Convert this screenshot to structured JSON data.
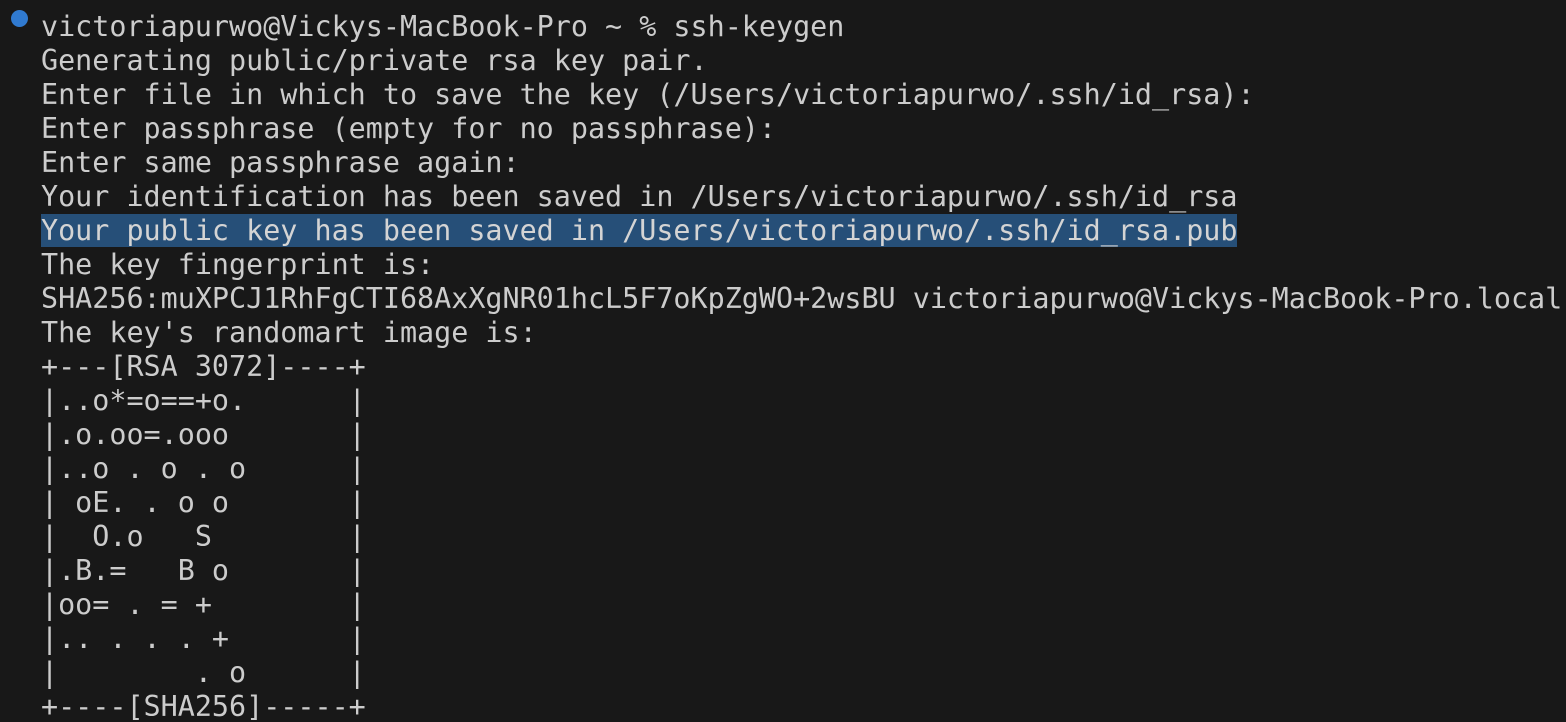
{
  "terminal": {
    "status_dot_color": "#3794ff",
    "highlight_color": "#264f78",
    "lines": [
      "victoriapurwo@Vickys-MacBook-Pro ~ % ssh-keygen",
      "Generating public/private rsa key pair.",
      "Enter file in which to save the key (/Users/victoriapurwo/.ssh/id_rsa):",
      "Enter passphrase (empty for no passphrase):",
      "Enter same passphrase again:",
      "Your identification has been saved in /Users/victoriapurwo/.ssh/id_rsa",
      "Your public key has been saved in /Users/victoriapurwo/.ssh/id_rsa.pub",
      "The key fingerprint is:",
      "SHA256:muXPCJ1RhFgCTI68AxXgNR01hcL5F7oKpZgWO+2wsBU victoriapurwo@Vickys-MacBook-Pro.local",
      "The key's randomart image is:",
      "+---[RSA 3072]----+",
      "|..o*=o==+o.      |",
      "|.o.oo=.ooo       |",
      "|..o . o . o      |",
      "| oE. . o o       |",
      "|  O.o   S        |",
      "|.B.=   B o       |",
      "|oo= . = +        |",
      "|.. . . . +       |",
      "|        . o      |",
      "+----[SHA256]-----+"
    ],
    "highlighted_line_index": 6
  }
}
